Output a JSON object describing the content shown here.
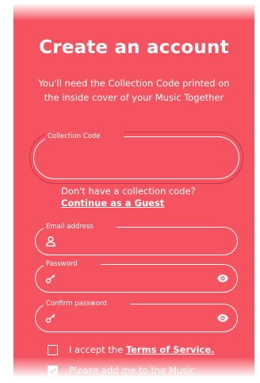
{
  "header": {
    "title": "Create an account",
    "subtitle": "You'll need the Collection Code printed on the inside cover of your Music Together"
  },
  "collection_code": {
    "label": "Collection Code",
    "value": ""
  },
  "no_code": {
    "text": "Don't have a collection code?",
    "guest_link": "Continue as a Guest"
  },
  "email": {
    "label": "Email address",
    "value": "",
    "icon": "user-icon"
  },
  "password": {
    "label": "Password",
    "value": "",
    "icon": "key-icon",
    "toggle_icon": "eye-icon"
  },
  "confirm_password": {
    "label": "Confirm password",
    "value": "",
    "icon": "key-icon",
    "toggle_icon": "eye-icon"
  },
  "terms": {
    "prefix": "I accept the ",
    "link": "Terms of Service.",
    "checked": false
  },
  "mailing": {
    "text": "Please add me to the Music Together Worldwide mailing list.",
    "checked": true
  },
  "colors": {
    "background": "#f4535f",
    "text": "#ffffff",
    "focus_ring": "#c43644"
  }
}
